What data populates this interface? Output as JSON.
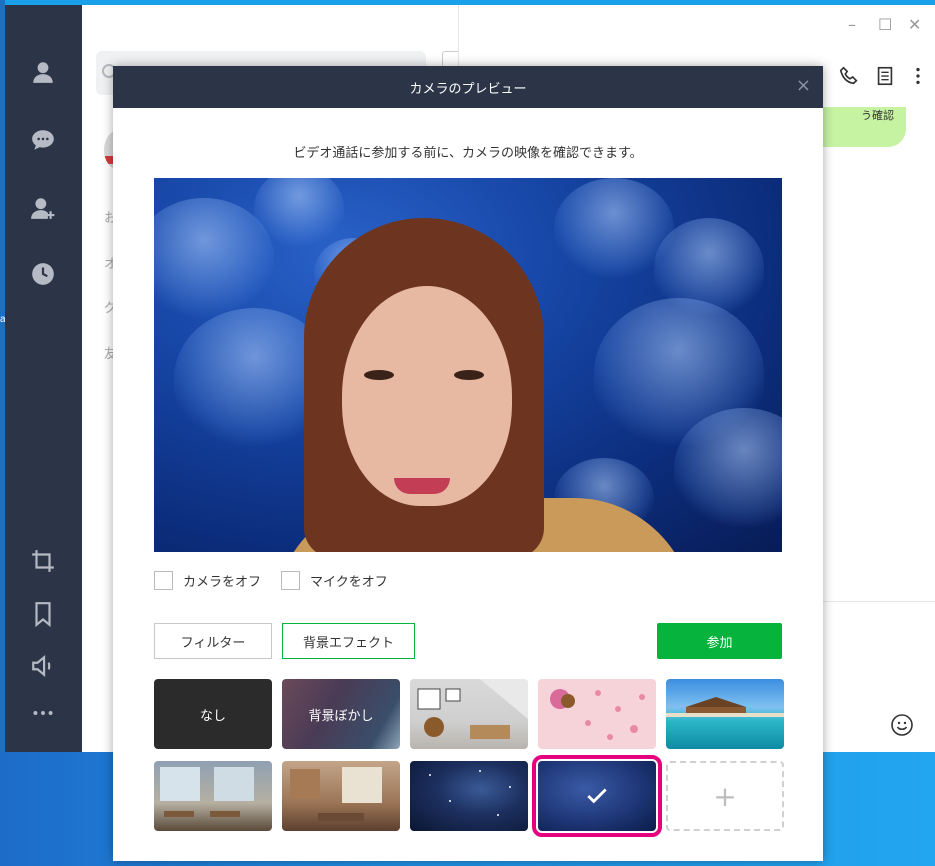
{
  "desktop": {
    "left_label": "a"
  },
  "window": {
    "minimize": "–",
    "maximize": "☐",
    "close": "✕"
  },
  "sidebar": {
    "items": [
      "person-icon",
      "chat-icon",
      "add-friend-icon",
      "clock-icon",
      "crop-icon",
      "bookmark-icon",
      "speaker-icon",
      "more-icon"
    ]
  },
  "list_pane": {
    "labels": [
      "お",
      "オ",
      "グ",
      "友"
    ]
  },
  "chat": {
    "bubble_text": "う確認",
    "accent_bubble": "#c6f3a2"
  },
  "modal": {
    "title": "カメラのプレビュー",
    "close": "×",
    "description": "ビデオ通話に参加する前に、カメラの映像を確認できます。",
    "camera_off_label": "カメラをオフ",
    "mic_off_label": "マイクをオフ",
    "filter_label": "フィルター",
    "bg_effect_label": "背景エフェクト",
    "join_label": "参加",
    "accent_color": "#06b33c",
    "selection_color": "#e5007e"
  },
  "backgrounds": [
    {
      "label": "なし",
      "icon": "none",
      "selected": false
    },
    {
      "label": "背景ぼかし",
      "icon": "blur",
      "selected": false
    },
    {
      "label": "",
      "icon": "brown-bear-room",
      "selected": false
    },
    {
      "label": "",
      "icon": "pink-hearts",
      "selected": false
    },
    {
      "label": "",
      "icon": "ocean-villa",
      "selected": false
    },
    {
      "label": "",
      "icon": "cafe-interior",
      "selected": false
    },
    {
      "label": "",
      "icon": "loft-interior",
      "selected": false
    },
    {
      "label": "",
      "icon": "starry-sky",
      "selected": false
    },
    {
      "label": "✓",
      "icon": "jellyfish",
      "selected": true
    },
    {
      "label": "+",
      "icon": "add-background",
      "selected": false
    }
  ]
}
